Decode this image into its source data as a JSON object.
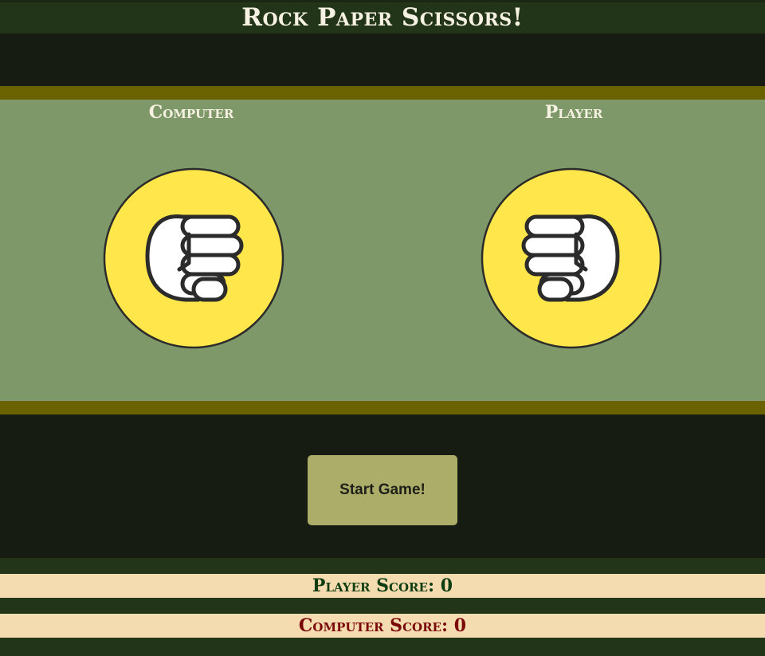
{
  "header": {
    "title": "Rock Paper Scissors!"
  },
  "arena": {
    "computer_label": "Computer",
    "player_label": "Player",
    "computer_choice_icon": "rock-fist-icon",
    "player_choice_icon": "rock-fist-icon"
  },
  "controls": {
    "start_label": "Start Game!"
  },
  "scores": {
    "player": "Player Score: 0",
    "computer": "Computer Score: 0"
  },
  "colors": {
    "header_bg": "#233518",
    "dark_band": "#171c13",
    "stripe": "#6a6200",
    "arena_bg": "#7e9869",
    "hand_circle": "#ffe64a",
    "button_bg": "#abad68",
    "score_bg": "#f5dbb0",
    "player_score_text": "#0f3d12",
    "computer_score_text": "#7a0a0a"
  }
}
